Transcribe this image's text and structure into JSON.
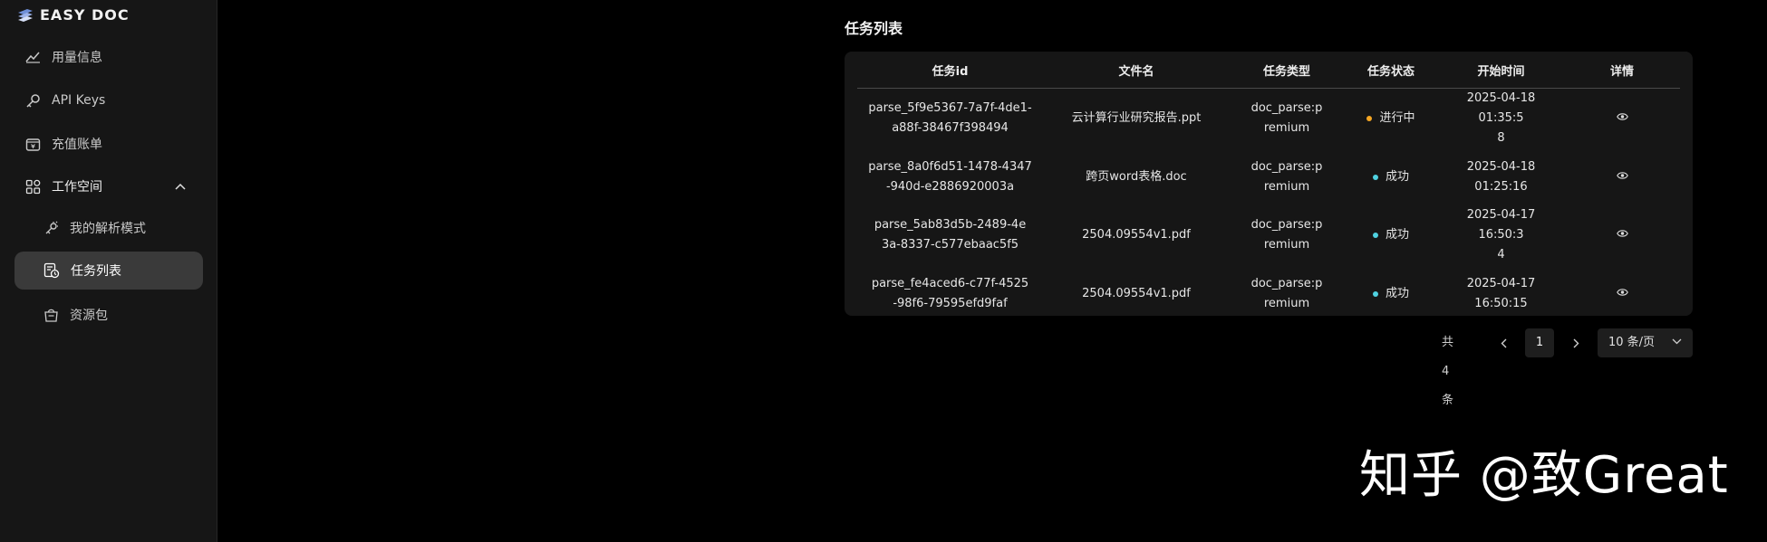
{
  "app": {
    "logo_text": "EASY DOC"
  },
  "sidebar": {
    "items": [
      {
        "label": "用量信息",
        "icon": "chart-line-icon"
      },
      {
        "label": "API Keys",
        "icon": "key-icon"
      },
      {
        "label": "充值账单",
        "icon": "bill-icon"
      },
      {
        "label": "工作空间",
        "icon": "grid-icon",
        "expanded": true
      },
      {
        "label": "我的解析模式",
        "icon": "settings-link-icon"
      },
      {
        "label": "任务列表",
        "icon": "task-list-icon",
        "active": true
      },
      {
        "label": "资源包",
        "icon": "package-icon"
      }
    ]
  },
  "main": {
    "title": "任务列表",
    "table": {
      "columns": [
        "任务id",
        "文件名",
        "任务类型",
        "任务状态",
        "开始时间",
        "详情"
      ],
      "rows": [
        {
          "id_line1": "parse_5f9e5367-7a7f-4de1-",
          "id_line2": "a88f-38467f398494",
          "file": "云计算行业研究报告.ppt",
          "type_line1": "doc_parse:p",
          "type_line2": "remium",
          "status": "进行中",
          "status_color": "#f5a623",
          "time_line1": "2025-04-18 01:35:5",
          "time_line2": "8"
        },
        {
          "id_line1": "parse_8a0f6d51-1478-4347",
          "id_line2": "-940d-e2886920003a",
          "file": "跨页word表格.doc",
          "type_line1": "doc_parse:p",
          "type_line2": "remium",
          "status": "成功",
          "status_color": "#4fd1e0",
          "time_line1": "2025-04-18 01:25:16",
          "time_line2": ""
        },
        {
          "id_line1": "parse_5ab83d5b-2489-4e",
          "id_line2": "3a-8337-c577ebaac5f5",
          "file": "2504.09554v1.pdf",
          "type_line1": "doc_parse:p",
          "type_line2": "remium",
          "status": "成功",
          "status_color": "#4fd1e0",
          "time_line1": "2025-04-17 16:50:3",
          "time_line2": "4"
        },
        {
          "id_line1": "parse_fe4aced6-c77f-4525",
          "id_line2": "-98f6-79595efd9faf",
          "file": "2504.09554v1.pdf",
          "type_line1": "doc_parse:p",
          "type_line2": "remium",
          "status": "成功",
          "status_color": "#4fd1e0",
          "time_line1": "2025-04-17 16:50:15",
          "time_line2": ""
        }
      ]
    },
    "pagination": {
      "total": "共 4 条",
      "current_page": "1",
      "page_size": "10 条/页"
    }
  },
  "watermark": {
    "text": "知乎 @致Great"
  }
}
